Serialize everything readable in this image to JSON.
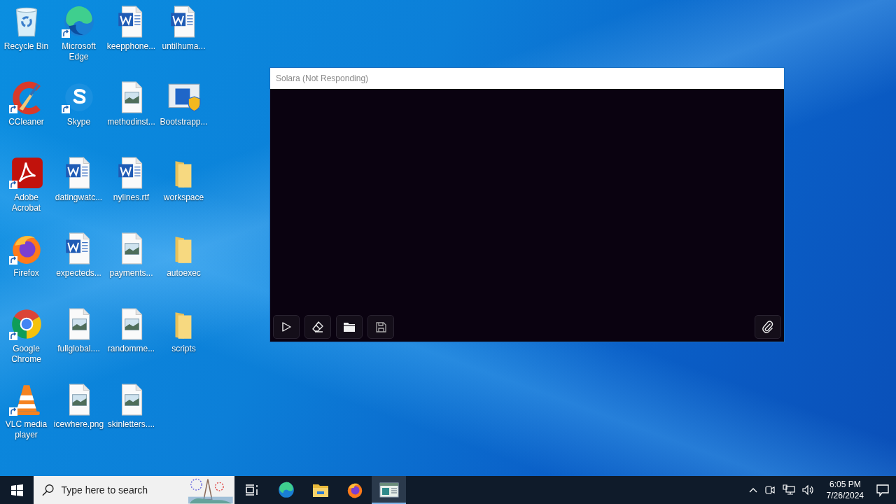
{
  "desktop": {
    "icons": [
      {
        "label": "Recycle Bin",
        "kind": "recycle-bin",
        "shortcut": false
      },
      {
        "label": "CCleaner",
        "kind": "ccleaner",
        "shortcut": true
      },
      {
        "label": "Adobe Acrobat",
        "kind": "acrobat",
        "shortcut": true
      },
      {
        "label": "Firefox",
        "kind": "firefox",
        "shortcut": true
      },
      {
        "label": "Google Chrome",
        "kind": "chrome",
        "shortcut": true
      },
      {
        "label": "VLC media player",
        "kind": "vlc",
        "shortcut": true
      },
      {
        "label": "Microsoft Edge",
        "kind": "edge",
        "shortcut": true
      },
      {
        "label": "Skype",
        "kind": "skype",
        "shortcut": true
      },
      {
        "label": "datingwatc...",
        "kind": "word",
        "shortcut": false
      },
      {
        "label": "expecteds...",
        "kind": "word",
        "shortcut": false
      },
      {
        "label": "fullglobal....",
        "kind": "image",
        "shortcut": false
      },
      {
        "label": "icewhere.png",
        "kind": "image",
        "shortcut": false
      },
      {
        "label": "keepphone...",
        "kind": "word",
        "shortcut": false
      },
      {
        "label": "methodinst...",
        "kind": "image",
        "shortcut": false
      },
      {
        "label": "nylines.rtf",
        "kind": "word",
        "shortcut": false
      },
      {
        "label": "payments...",
        "kind": "image",
        "shortcut": false
      },
      {
        "label": "randomme...",
        "kind": "image",
        "shortcut": false
      },
      {
        "label": "skinletters....",
        "kind": "image",
        "shortcut": false
      },
      {
        "label": "untilhuma...",
        "kind": "word",
        "shortcut": false
      },
      {
        "label": "Bootstrapp...",
        "kind": "installer",
        "shortcut": false
      },
      {
        "label": "workspace",
        "kind": "folder",
        "shortcut": false
      },
      {
        "label": "autoexec",
        "kind": "folder",
        "shortcut": false
      },
      {
        "label": "scripts",
        "kind": "folder",
        "shortcut": false
      }
    ]
  },
  "window": {
    "title": "Solara (Not Responding)"
  },
  "taskbar": {
    "search": {
      "placeholder": "Type here to search"
    },
    "apps": [
      {
        "kind": "task-view",
        "selected": false
      },
      {
        "kind": "edge",
        "selected": false
      },
      {
        "kind": "explorer",
        "selected": false
      },
      {
        "kind": "firefox",
        "selected": false
      },
      {
        "kind": "solara",
        "selected": true
      }
    ],
    "clock": {
      "time": "6:05 PM",
      "date": "7/26/2024"
    }
  }
}
